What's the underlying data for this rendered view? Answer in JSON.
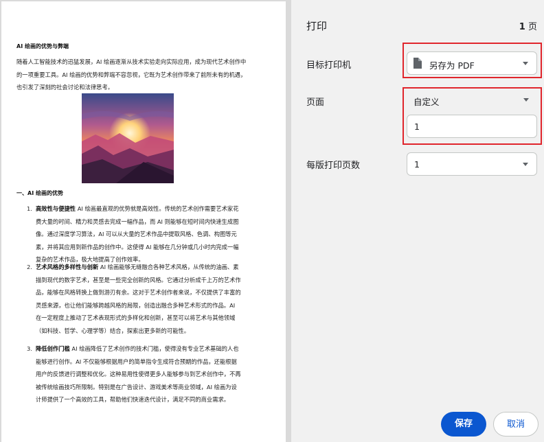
{
  "document": {
    "title": "AI 绘画的优势与弊端",
    "intro": "随着人工智能技术的迅猛发展，AI 绘画逐渐从技术实验走向实际应用，成为现代艺术创作中的一项重要工具。AI 绘画的优势和弊端不容忽视，它既为艺术创作带来了前所未有的机遇，也引发了深刻的社会讨论和法律思考。",
    "section_heading": "一、AI 绘画的优势",
    "items": [
      {
        "num": "1.",
        "bold": "高效性与便捷性",
        "text": " AI 绘画最直观的优势就是高效性。传统的艺术创作需要艺术家花费大量的时间、精力和灵感去完成一幅作品，而 AI 则能够在短时间内快速生成图像。通过深度学习算法，AI 可以从大量的艺术作品中提取风格、色调、构图等元素，并将其应用到新作品的创作中。这使得 AI 能够在几分钟或几小时内完成一幅复杂的艺术作品，极大地提高了创作效率。"
      },
      {
        "num": "2.",
        "bold": "艺术风格的多样性与创新",
        "text": " AI 绘画能够无缝融合各种艺术风格，从传统的油画、素描到现代的数字艺术，甚至是一些完全创新的风格。它通过分析成千上万的艺术作品，能够在风格转换上做到游刃有余。这对于艺术创作者来说，不仅提供了丰富的灵感来源，也让他们能够跨越风格的局限，创造出融合多种艺术形式的作品。AI 在一定程度上推动了艺术表现形式的多样化和创新，甚至可以将艺术与其他领域（如科技、哲学、心理学等）结合，探索出更多新的可能性。"
      },
      {
        "num": "3.",
        "bold": "降低创作门槛",
        "text": " AI 绘画降低了艺术创作的技术门槛，使得没有专业艺术基础的人也能够进行创作。AI 不仅能够根据用户的简单指令生成符合预期的作品，还能根据用户的反馈进行调整和优化。这种易用性使得更多人能够参与到艺术创作中，不再被传统绘画技巧所限制。特别是在广告设计、游戏美术等商业领域，AI 绘画为设计师提供了一个高效的工具，帮助他们快速迭代设计，满足不同的商业需求。"
      }
    ]
  },
  "settings": {
    "title": "打印",
    "page_count": "1",
    "page_unit": "页",
    "destination_label": "目标打印机",
    "destination_value": "另存为 PDF",
    "destination_icon": "file-icon",
    "pages_label": "页面",
    "pages_value": "自定义",
    "pages_input": "1",
    "per_sheet_label": "每版打印页数",
    "per_sheet_value": "1",
    "save_label": "保存",
    "cancel_label": "取消"
  },
  "colors": {
    "accent": "#0b57d0",
    "highlight": "#e0242b"
  }
}
